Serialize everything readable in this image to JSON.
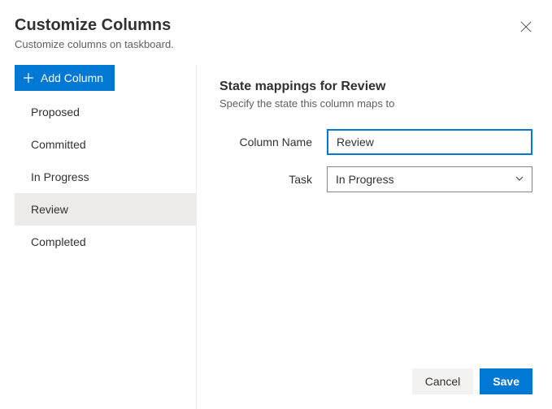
{
  "header": {
    "title": "Customize Columns",
    "subtitle": "Customize columns on taskboard."
  },
  "sidebar": {
    "add_label": "Add Column",
    "items": [
      {
        "label": "Proposed",
        "selected": false
      },
      {
        "label": "Committed",
        "selected": false
      },
      {
        "label": "In Progress",
        "selected": false
      },
      {
        "label": "Review",
        "selected": true
      },
      {
        "label": "Completed",
        "selected": false
      }
    ]
  },
  "content": {
    "section_title": "State mappings for Review",
    "section_sub": "Specify the state this column maps to",
    "column_name_label": "Column Name",
    "column_name_value": "Review",
    "task_label": "Task",
    "task_value": "In Progress"
  },
  "footer": {
    "cancel": "Cancel",
    "save": "Save"
  }
}
